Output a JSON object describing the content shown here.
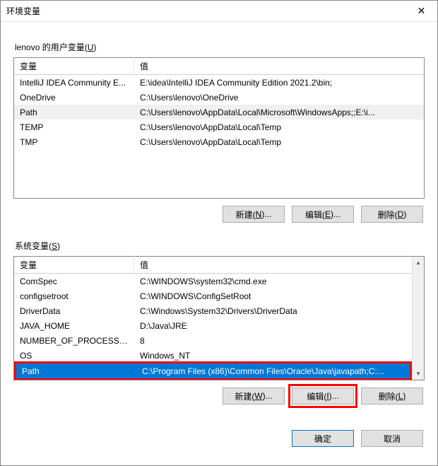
{
  "window": {
    "title": "环境变量"
  },
  "user_section": {
    "label_prefix": "lenovo 的用户变量(",
    "label_key": "U",
    "label_suffix": ")",
    "columns": {
      "name": "变量",
      "value": "值"
    },
    "rows": [
      {
        "name": "IntelliJ IDEA Community E...",
        "value": "E:\\idea\\IntelliJ IDEA Community Edition 2021.2\\bin;"
      },
      {
        "name": "OneDrive",
        "value": "C:\\Users\\lenovo\\OneDrive"
      },
      {
        "name": "Path",
        "value": "C:\\Users\\lenovo\\AppData\\Local\\Microsoft\\WindowsApps;;E:\\i..."
      },
      {
        "name": "TEMP",
        "value": "C:\\Users\\lenovo\\AppData\\Local\\Temp"
      },
      {
        "name": "TMP",
        "value": "C:\\Users\\lenovo\\AppData\\Local\\Temp"
      }
    ],
    "selected_index": 2,
    "buttons": {
      "new_pre": "新建(",
      "new_key": "N",
      "new_post": ")...",
      "edit_pre": "编辑(",
      "edit_key": "E",
      "edit_post": ")...",
      "del_pre": "删除(",
      "del_key": "D",
      "del_post": ")"
    }
  },
  "system_section": {
    "label_prefix": "系统变量(",
    "label_key": "S",
    "label_suffix": ")",
    "columns": {
      "name": "变量",
      "value": "值"
    },
    "rows": [
      {
        "name": "ComSpec",
        "value": "C:\\WINDOWS\\system32\\cmd.exe"
      },
      {
        "name": "configsetroot",
        "value": "C:\\WINDOWS\\ConfigSetRoot"
      },
      {
        "name": "DriverData",
        "value": "C:\\Windows\\System32\\Drivers\\DriverData"
      },
      {
        "name": "JAVA_HOME",
        "value": "D:\\Java\\JRE"
      },
      {
        "name": "NUMBER_OF_PROCESSORS",
        "value": "8"
      },
      {
        "name": "OS",
        "value": "Windows_NT"
      },
      {
        "name": "Path",
        "value": "C:\\Program Files (x86)\\Common Files\\Oracle\\Java\\javapath;C:..."
      }
    ],
    "selected_index": 6,
    "buttons": {
      "new_pre": "新建(",
      "new_key": "W",
      "new_post": ")...",
      "edit_pre": "编辑(",
      "edit_key": "I",
      "edit_post": ")...",
      "del_pre": "删除(",
      "del_key": "L",
      "del_post": ")"
    }
  },
  "footer": {
    "ok": "确定",
    "cancel": "取消"
  }
}
